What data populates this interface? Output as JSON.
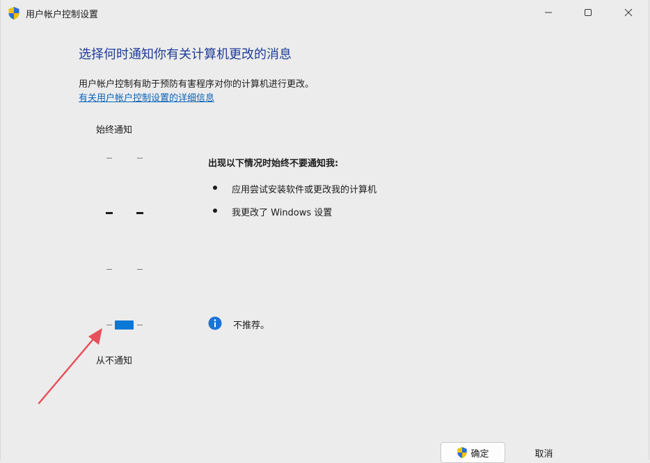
{
  "window": {
    "title": "用户帐户控制设置"
  },
  "content": {
    "heading": "选择何时通知你有关计算机更改的消息",
    "description": "用户帐户控制有助于预防有害程序对你的计算机进行更改。",
    "more_link": "有关用户帐户控制设置的详细信息"
  },
  "slider": {
    "top_label": "始终通知",
    "bottom_label": "从不通知",
    "levels": 4,
    "selected_level": 1
  },
  "panel": {
    "title": "出现以下情况时始终不要通知我:",
    "bullets": [
      "应用尝试安装软件或更改我的计算机",
      "我更改了 Windows 设置"
    ],
    "info_text": "不推荐。"
  },
  "buttons": {
    "ok": "确定",
    "cancel": "取消"
  },
  "colors": {
    "accent": "#0a78d7",
    "heading": "#1e3c96",
    "link": "#0b63b6",
    "annotation_arrow": "#e8505b"
  },
  "icons": {
    "app": "uac-shield-icon",
    "info": "info-icon",
    "ok_button": "uac-shield-icon"
  }
}
